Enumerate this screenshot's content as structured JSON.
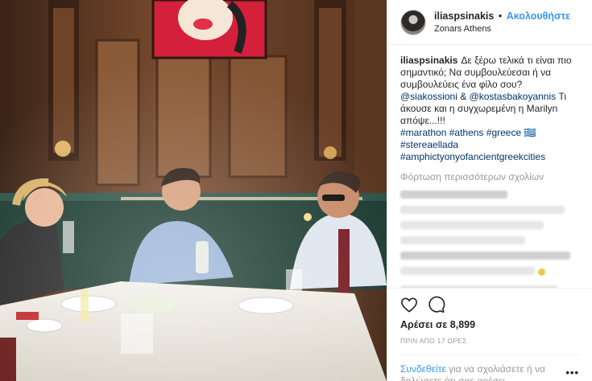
{
  "post": {
    "username": "iliaspsinakis",
    "separator": "•",
    "follow_label": "Ακολουθήστε",
    "location": "Zonars Athens"
  },
  "caption": {
    "username": "iliaspsinakis",
    "text_1": "Δε ξέρω τελικά τι είναι πιο σημαντικό; Να συμβουλεύεσαι ή να συμβουλεύεις ένα φίλο σου?",
    "mention_1": "@siakossioni",
    "amp": "&",
    "mention_2": "@kostasbakoyannis",
    "text_2": "Τι άκουσε και η συγχωρεμένη η Marilyn απόψε...!!!",
    "hashtags": [
      "#marathon",
      "#athens",
      "#greece"
    ],
    "flag": "🇬🇷",
    "hashtag_2": "#stereaellada",
    "hashtag_3": "#amphictyonyofancientgreekcities"
  },
  "comments": {
    "load_more": "Φόρτωση περισσότερων σχολίων"
  },
  "actions": {
    "like_icon": "heart-icon",
    "comment_icon": "comment-bubble-icon",
    "likes": "Αρέσει σε 8,899",
    "time_ago": "ΠΡΙΝ ΑΠΟ 17 ΩΡΕΣ"
  },
  "footer": {
    "login_link": "Συνδεθείτε",
    "login_text": "για να σχολιάσετε ή να δηλώσετε ότι σας αρέσει.",
    "options": "•••"
  },
  "colors": {
    "accent_blue": "#3897f0",
    "link_navy": "#003569",
    "muted_gray": "#999999",
    "text": "#262626",
    "border": "#efefef"
  }
}
